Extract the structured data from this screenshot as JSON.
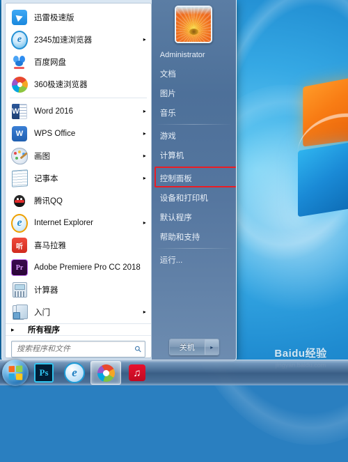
{
  "desktop": {
    "watermark_main": "Baidu经验",
    "watermark_sub": "jingyan.baidu.com"
  },
  "start_menu": {
    "programs": [
      {
        "label": "迅雷极速版",
        "icon": "thunder-icon",
        "arrow": ""
      },
      {
        "label": "2345加速浏览器",
        "icon": "2345-icon",
        "arrow": "▸"
      },
      {
        "label": "百度网盘",
        "icon": "baidu-pan-icon",
        "arrow": ""
      },
      {
        "label": "360极速浏览器",
        "icon": "360-icon",
        "arrow": ""
      },
      {
        "label": "Word 2016",
        "icon": "word-icon",
        "arrow": "▸"
      },
      {
        "label": "WPS Office",
        "icon": "wps-icon",
        "arrow": "▸"
      },
      {
        "label": "画图",
        "icon": "paint-icon",
        "arrow": "▸"
      },
      {
        "label": "记事本",
        "icon": "notepad-icon",
        "arrow": "▸"
      },
      {
        "label": "腾讯QQ",
        "icon": "qq-icon",
        "arrow": ""
      },
      {
        "label": "Internet Explorer",
        "icon": "ie-icon",
        "arrow": "▸"
      },
      {
        "label": "喜马拉雅",
        "icon": "ximalaya-icon",
        "arrow": ""
      },
      {
        "label": "Adobe Premiere Pro CC 2018",
        "icon": "premiere-icon",
        "arrow": ""
      },
      {
        "label": "计算器",
        "icon": "calculator-icon",
        "arrow": ""
      },
      {
        "label": "入门",
        "icon": "getting-started-icon",
        "arrow": "▸"
      }
    ],
    "all_programs": {
      "label": "所有程序",
      "arrow": "▸"
    },
    "search": {
      "placeholder": "搜索程序和文件",
      "value": "",
      "icon": "search-icon"
    },
    "right_items": [
      {
        "label": "Administrator"
      },
      {
        "label": "文档"
      },
      {
        "label": "图片"
      },
      {
        "label": "音乐"
      },
      {
        "label": "游戏"
      },
      {
        "label": "计算机"
      },
      {
        "label": "控制面板"
      },
      {
        "label": "设备和打印机"
      },
      {
        "label": "默认程序"
      },
      {
        "label": "帮助和支持"
      },
      {
        "label": "运行..."
      }
    ],
    "highlight": {
      "target": "控制面板",
      "color": "#ec1c24"
    },
    "shutdown": {
      "label": "关机",
      "arrow": "▸"
    },
    "avatar_name": "flower-avatar"
  },
  "taskbar": {
    "start_button": "start-orb",
    "buttons": [
      {
        "name": "photoshop",
        "glyph": "Ps",
        "active": false
      },
      {
        "name": "internet-explorer",
        "glyph": "e",
        "active": false
      },
      {
        "name": "chrome-browser",
        "glyph": "",
        "active": true
      },
      {
        "name": "netease-music",
        "glyph": "♫",
        "active": false
      }
    ]
  }
}
